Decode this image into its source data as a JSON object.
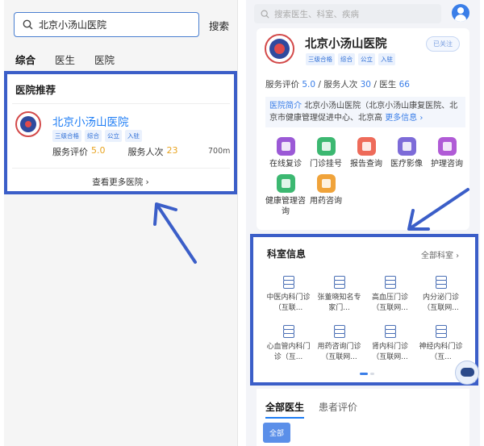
{
  "left": {
    "search": {
      "query": "北京小汤山医院",
      "button": "搜索"
    },
    "tabs": [
      "综合",
      "医生",
      "医院"
    ],
    "card": {
      "title": "医院推荐",
      "hospital_name": "北京小汤山医院",
      "tags": [
        "三级合格",
        "综合",
        "公立",
        "入驻"
      ],
      "rating_label": "服务评价",
      "rating": "5.0",
      "visits_label": "服务人次",
      "visits": "23",
      "distance": "700m",
      "more": "查看更多医院 ›"
    }
  },
  "right": {
    "search_placeholder": "搜索医生、科室、疾病",
    "hospital_name": "北京小汤山医院",
    "follow": "已关注",
    "tags": [
      "三级合格",
      "综合",
      "公立",
      "入驻"
    ],
    "stats": {
      "rating_label": "服务评价",
      "rating": "5.0",
      "visits_label": "服务人次",
      "visits": "30",
      "doctors_label": "医生",
      "doctors": "66"
    },
    "intro": {
      "label": "医院简介",
      "text": "北京小汤山医院（北京小汤山康复医院、北京市健康管理促进中心、北京高",
      "more": "更多信息 ›"
    },
    "services": [
      {
        "label": "在线复诊",
        "icon": "chat-icon",
        "color": "#9b59d6"
      },
      {
        "label": "门诊挂号",
        "icon": "calendar-icon",
        "color": "#3cb871"
      },
      {
        "label": "报告查询",
        "icon": "report-icon",
        "color": "#ee6b5a"
      },
      {
        "label": "医疗影像",
        "icon": "image-icon",
        "color": "#7d6bd8"
      },
      {
        "label": "护理咨询",
        "icon": "nursing-icon",
        "color": "#b05bd6"
      },
      {
        "label": "健康管理咨询",
        "icon": "health-icon",
        "color": "#3cb871"
      },
      {
        "label": "用药咨询",
        "icon": "medicine-icon",
        "color": "#f0a33a"
      }
    ],
    "dept": {
      "title": "科室信息",
      "all": "全部科室 ›",
      "items": [
        "中医内科门诊（互联...",
        "张董晓知名专家门...",
        "高血压门诊（互联网...",
        "内分泌门诊（互联网...",
        "心血管内科门诊（互...",
        "用药咨询门诊（互联网...",
        "肾内科门诊（互联网...",
        "神经内科门诊（互..."
      ]
    },
    "bottom": {
      "tabs": [
        "全部医生",
        "患者评价"
      ],
      "all_button": "全部"
    }
  },
  "annotation_color": "#3b5ec8"
}
